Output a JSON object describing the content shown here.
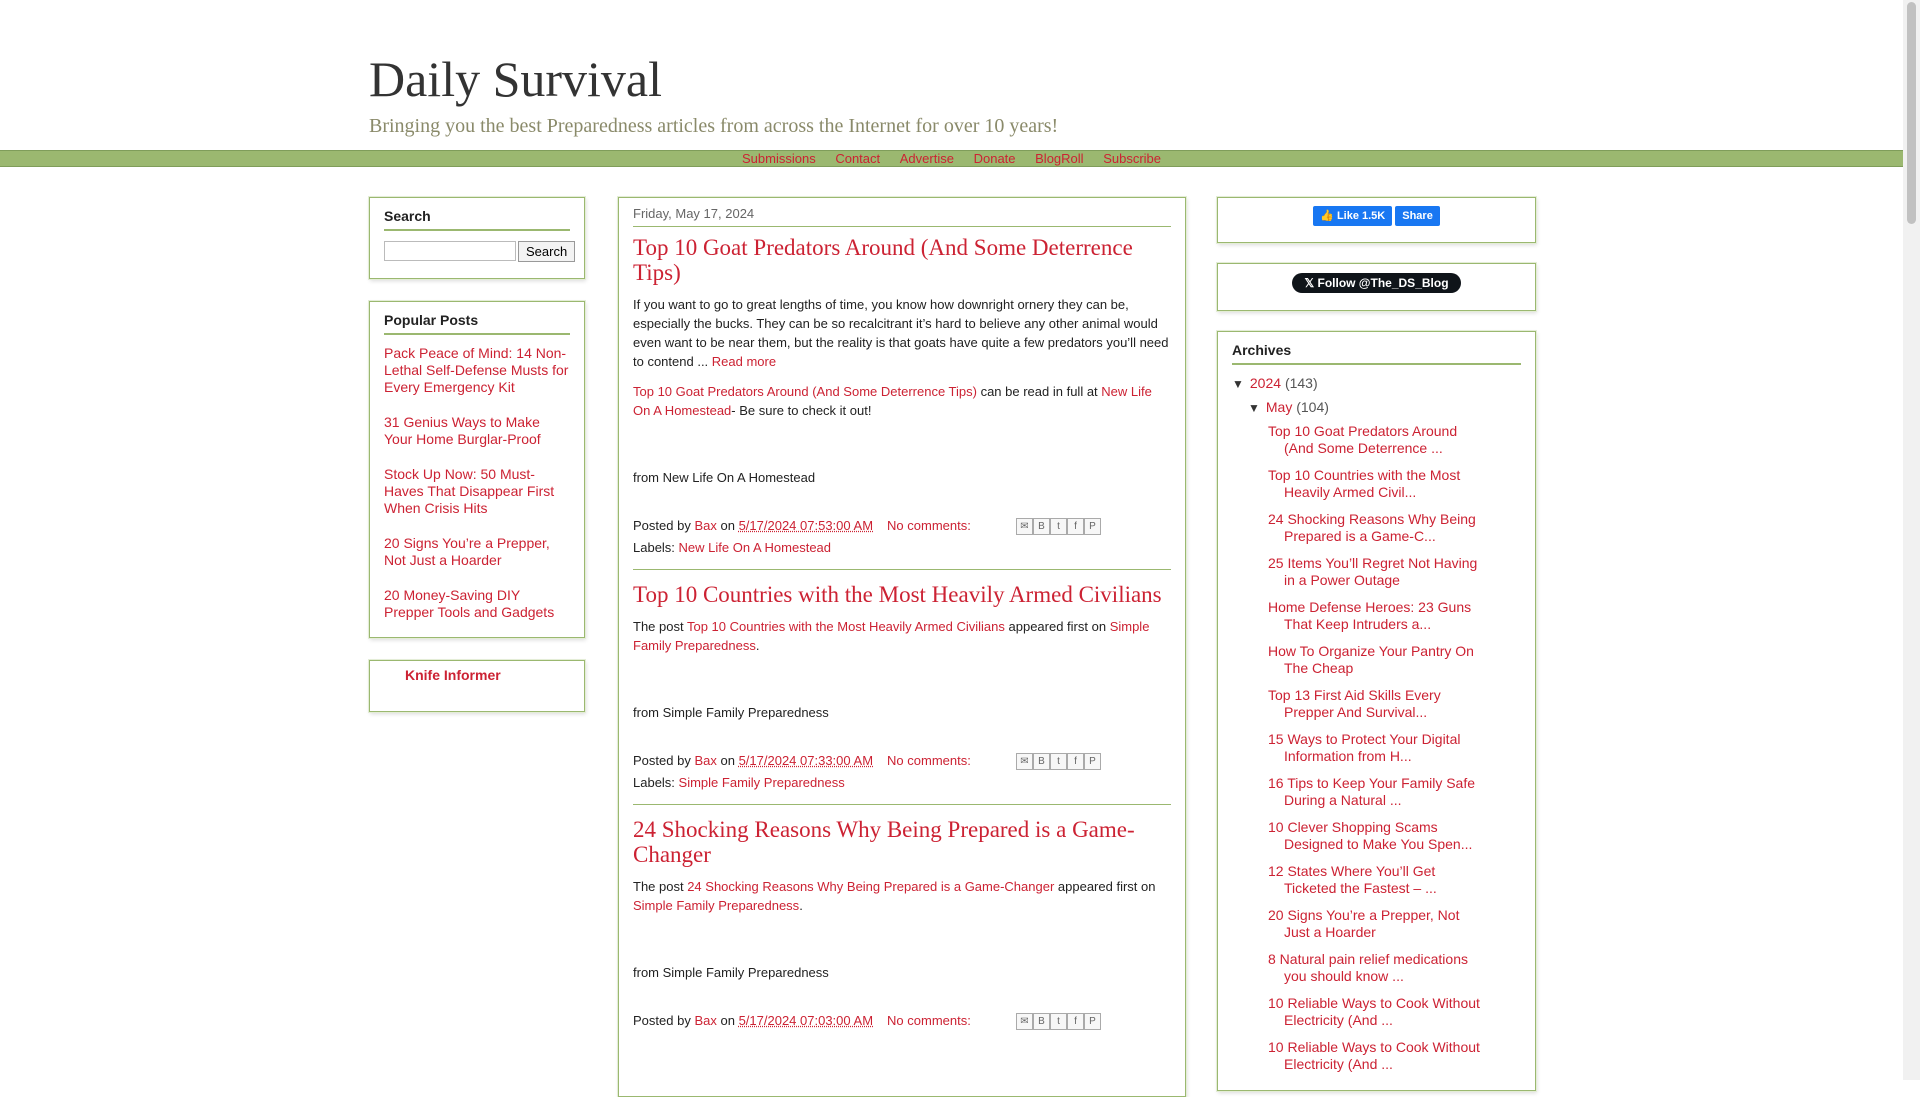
{
  "site": {
    "title": "Daily Survival",
    "description": "Bringing you the best Preparedness articles from across the Internet for over 10 years!"
  },
  "nav": [
    "Submissions",
    "Contact",
    "Advertise",
    "Donate",
    "BlogRoll",
    "Subscribe"
  ],
  "search": {
    "title": "Search",
    "input_value": "",
    "button_label": "Search"
  },
  "popular": {
    "title": "Popular Posts",
    "items": [
      "Pack Peace of Mind: 14 Non-Lethal Self-Defense Musts for Every Emergency Kit",
      "31 Genius Ways to Make Your Home Burglar-Proof",
      "Stock Up Now: 50 Must-Haves That Disappear First When Crisis Hits",
      "20 Signs You’re a Prepper, Not Just a Hoarder",
      "20 Money-Saving DIY Prepper Tools and Gadgets"
    ]
  },
  "knife": {
    "label": "Knife Informer"
  },
  "main": {
    "date": "Friday, May 17, 2024",
    "posts": [
      {
        "title": "Top 10 Goat Predators Around (And Some Deterrence Tips)",
        "excerpt": "If you want to go to great lengths of time, you know how downright ornery they can be, especially the bucks. They can be so recalcitrant it’s hard to believe any other animal would even want to be near them, but the reality is that goats have quite a few predators you’ll need to contend ... ",
        "read_more": "Read more",
        "link_title": "Top 10 Goat Predators Around (And Some Deterrence Tips)",
        "link_mid": " can be read in full at ",
        "source_link": "New Life On A Homestead",
        "link_end": "- Be sure to check it out!",
        "from": "from New Life On A Homestead",
        "posted_by": "Posted by ",
        "author": "Bax",
        "on": " on ",
        "time": "5/17/2024 07:53:00 AM",
        "comments": "No comments:",
        "labels_prefix": "Labels: ",
        "label": "New Life On A Homestead"
      },
      {
        "title": "Top 10 Countries with the Most Heavily Armed Civilians",
        "the_post": "The post ",
        "post_link": "Top 10 Countries with the Most Heavily Armed Civilians",
        "appeared": " appeared first on ",
        "source_link": "Simple Family Preparedness",
        "end": ".",
        "from": "from Simple Family Preparedness",
        "posted_by": "Posted by ",
        "author": "Bax",
        "on": " on ",
        "time": "5/17/2024 07:33:00 AM",
        "comments": "No comments:",
        "labels_prefix": "Labels: ",
        "label": "Simple Family Preparedness"
      },
      {
        "title": "24 Shocking Reasons Why Being Prepared is a Game-Changer",
        "the_post": "The post ",
        "post_link": "24 Shocking Reasons Why Being Prepared is a Game-Changer",
        "appeared": " appeared first on ",
        "source_link": "Simple Family Preparedness",
        "end": ".",
        "from": "from Simple Family Preparedness",
        "posted_by": "Posted by ",
        "author": "Bax",
        "on": " on ",
        "time": "5/17/2024 07:03:00 AM",
        "comments": "No comments:"
      }
    ]
  },
  "social": {
    "fb_like": "Like 1.5K",
    "fb_share": "Share",
    "twitter_follow": "Follow @The_DS_Blog"
  },
  "archives": {
    "title": "Archives",
    "year": "2024",
    "year_count": "(143)",
    "month": "May",
    "month_count": "(104)",
    "posts": [
      "Top 10 Goat Predators Around (And Some Deterrence ...",
      "Top 10 Countries with the Most Heavily Armed Civil...",
      "24 Shocking Reasons Why Being Prepared is a Game-C...",
      "25 Items You’ll Regret Not Having in a Power Outage",
      "Home Defense Heroes: 23 Guns That Keep Intruders a...",
      "How To Organize Your Pantry On The Cheap",
      "Top 13 First Aid Skills Every Prepper And Survival...",
      "15 Ways to Protect Your Digital Information from H...",
      "16 Tips to Keep Your Family Safe During a Natural ...",
      "10 Clever Shopping Scams Designed to Make You Spen...",
      "12 States Where You’ll Get Ticketed the Fastest – ...",
      "20 Signs You’re a Prepper, Not Just a Hoarder",
      "8 Natural pain relief medications you should know ...",
      "10 Reliable Ways to Cook Without Electricity (And ...",
      "10 Reliable Ways to Cook Without Electricity (And ..."
    ]
  }
}
